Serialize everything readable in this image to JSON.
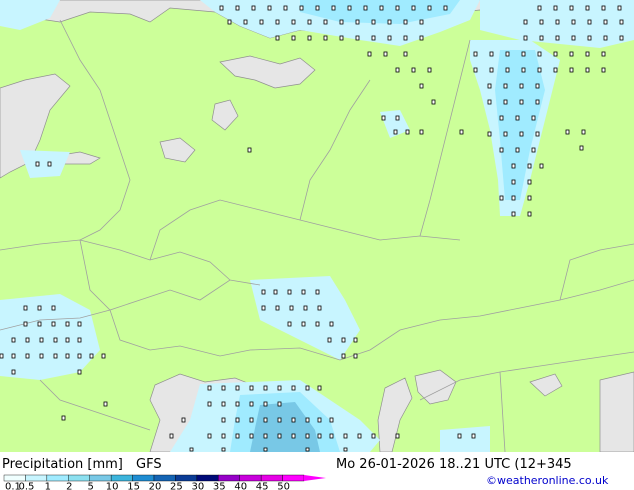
{
  "legend": {
    "title": "Precipitation [mm]",
    "model": "GFS",
    "labels": [
      "0.1",
      "0.5",
      "1",
      "2",
      "5",
      "10",
      "15",
      "20",
      "25",
      "30",
      "35",
      "40",
      "45",
      "50"
    ],
    "colors": [
      "#f0ffff",
      "#c8f5ff",
      "#a0ebff",
      "#8ce0f0",
      "#78c8e6",
      "#3cb4dc",
      "#1e8cd2",
      "#1464b4",
      "#0a3c96",
      "#000a78",
      "#9600c8",
      "#c800dc",
      "#e600e6",
      "#ff00ff"
    ]
  },
  "valid_time": "Mo 26-01-2026 18..21 UTC (12+345",
  "credit": "©weatheronline.co.uk",
  "colors": {
    "land": "#ccff99",
    "sea": "#e6e6e6",
    "precip_light": "#c8f5ff",
    "precip_medium": "#a0ebff",
    "precip_heavy": "#78c8e6",
    "border": "#a0a0a0"
  }
}
